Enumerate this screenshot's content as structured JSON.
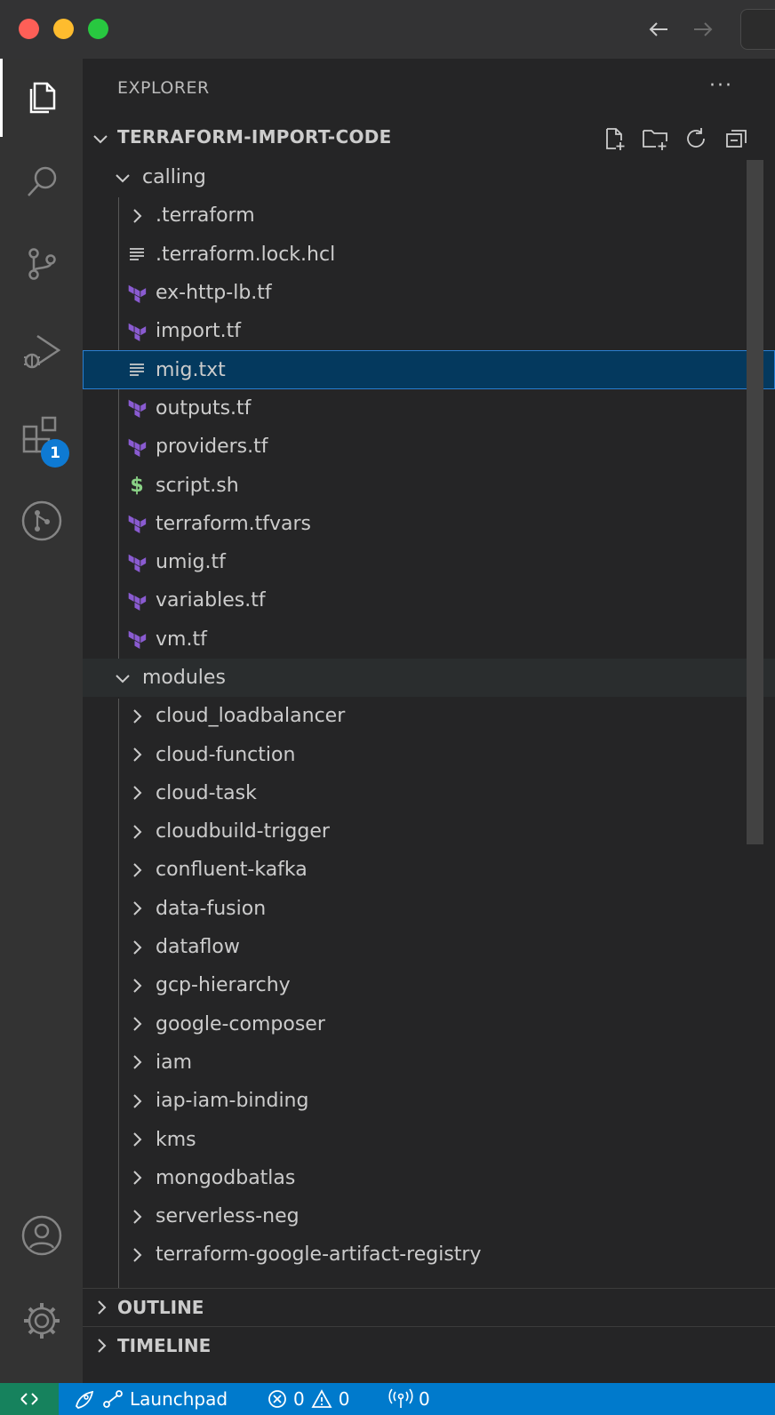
{
  "sidebar": {
    "title": "EXPLORER",
    "root": "TERRAFORM-IMPORT-CODE",
    "tree": [
      {
        "label": "calling",
        "type": "folder-open",
        "level": 0
      },
      {
        "label": ".terraform",
        "type": "folder",
        "level": 1
      },
      {
        "label": ".terraform.lock.hcl",
        "type": "text",
        "level": 1
      },
      {
        "label": "ex-http-lb.tf",
        "type": "tf",
        "level": 1
      },
      {
        "label": "import.tf",
        "type": "tf",
        "level": 1
      },
      {
        "label": "mig.txt",
        "type": "text",
        "level": 1,
        "selected": true
      },
      {
        "label": "outputs.tf",
        "type": "tf",
        "level": 1
      },
      {
        "label": "providers.tf",
        "type": "tf",
        "level": 1
      },
      {
        "label": "script.sh",
        "type": "shell",
        "level": 1
      },
      {
        "label": "terraform.tfvars",
        "type": "tf",
        "level": 1
      },
      {
        "label": "umig.tf",
        "type": "tf",
        "level": 1
      },
      {
        "label": "variables.tf",
        "type": "tf",
        "level": 1
      },
      {
        "label": "vm.tf",
        "type": "tf",
        "level": 1
      },
      {
        "label": "modules",
        "type": "folder-open",
        "level": 0,
        "hover": true
      },
      {
        "label": "cloud_loadbalancer",
        "type": "folder",
        "level": 1
      },
      {
        "label": "cloud-function",
        "type": "folder",
        "level": 1
      },
      {
        "label": "cloud-task",
        "type": "folder",
        "level": 1
      },
      {
        "label": "cloudbuild-trigger",
        "type": "folder",
        "level": 1
      },
      {
        "label": "confluent-kafka",
        "type": "folder",
        "level": 1
      },
      {
        "label": "data-fusion",
        "type": "folder",
        "level": 1
      },
      {
        "label": "dataflow",
        "type": "folder",
        "level": 1
      },
      {
        "label": "gcp-hierarchy",
        "type": "folder",
        "level": 1
      },
      {
        "label": "google-composer",
        "type": "folder",
        "level": 1
      },
      {
        "label": "iam",
        "type": "folder",
        "level": 1
      },
      {
        "label": "iap-iam-binding",
        "type": "folder",
        "level": 1
      },
      {
        "label": "kms",
        "type": "folder",
        "level": 1
      },
      {
        "label": "mongodbatlas",
        "type": "folder",
        "level": 1
      },
      {
        "label": "serverless-neg",
        "type": "folder",
        "level": 1
      },
      {
        "label": "terraform-google-artifact-registry",
        "type": "folder",
        "level": 1
      }
    ]
  },
  "panels": {
    "outline": "OUTLINE",
    "timeline": "TIMELINE"
  },
  "activity": {
    "extensions_badge": "1"
  },
  "statusbar": {
    "launchpad": "Launchpad",
    "errors": "0",
    "warnings": "0",
    "ports": "0"
  },
  "colors": {
    "terraform": "#8a5bd1",
    "shell": "#89d185",
    "accent": "#007acc",
    "selection": "#04395e"
  }
}
